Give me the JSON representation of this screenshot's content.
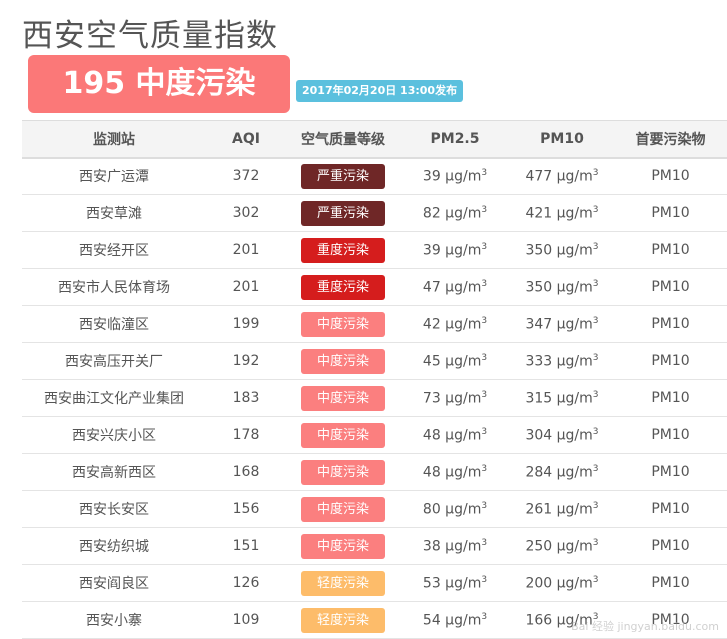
{
  "title": "西安空气质量指数",
  "summary": {
    "aqi_text": "195 中度污染",
    "published": "2017年02月20日 13:00发布"
  },
  "table": {
    "headers": [
      "监测站",
      "AQI",
      "空气质量等级",
      "PM2.5",
      "PM10",
      "首要污染物"
    ],
    "rows": [
      {
        "station": "西安广运潭",
        "aqi": "372",
        "level": "严重污染",
        "color": "#6f2727",
        "pm25": "39 μg/m",
        "pm10": "477 μg/m",
        "primary": "PM10"
      },
      {
        "station": "西安草滩",
        "aqi": "302",
        "level": "严重污染",
        "color": "#6f2727",
        "pm25": "82 μg/m",
        "pm10": "421 μg/m",
        "primary": "PM10"
      },
      {
        "station": "西安经开区",
        "aqi": "201",
        "level": "重度污染",
        "color": "#d51d1d",
        "pm25": "39 μg/m",
        "pm10": "350 μg/m",
        "primary": "PM10"
      },
      {
        "station": "西安市人民体育场",
        "aqi": "201",
        "level": "重度污染",
        "color": "#d51d1d",
        "pm25": "47 μg/m",
        "pm10": "350 μg/m",
        "primary": "PM10"
      },
      {
        "station": "西安临潼区",
        "aqi": "199",
        "level": "中度污染",
        "color": "#fb7f7f",
        "pm25": "42 μg/m",
        "pm10": "347 μg/m",
        "primary": "PM10"
      },
      {
        "station": "西安高压开关厂",
        "aqi": "192",
        "level": "中度污染",
        "color": "#fb7f7f",
        "pm25": "45 μg/m",
        "pm10": "333 μg/m",
        "primary": "PM10"
      },
      {
        "station": "西安曲江文化产业集团",
        "aqi": "183",
        "level": "中度污染",
        "color": "#fb7f7f",
        "pm25": "73 μg/m",
        "pm10": "315 μg/m",
        "primary": "PM10"
      },
      {
        "station": "西安兴庆小区",
        "aqi": "178",
        "level": "中度污染",
        "color": "#fb7f7f",
        "pm25": "48 μg/m",
        "pm10": "304 μg/m",
        "primary": "PM10"
      },
      {
        "station": "西安高新西区",
        "aqi": "168",
        "level": "中度污染",
        "color": "#fb7f7f",
        "pm25": "48 μg/m",
        "pm10": "284 μg/m",
        "primary": "PM10"
      },
      {
        "station": "西安长安区",
        "aqi": "156",
        "level": "中度污染",
        "color": "#fb7f7f",
        "pm25": "80 μg/m",
        "pm10": "261 μg/m",
        "primary": "PM10"
      },
      {
        "station": "西安纺织城",
        "aqi": "151",
        "level": "中度污染",
        "color": "#fb7f7f",
        "pm25": "38 μg/m",
        "pm10": "250 μg/m",
        "primary": "PM10"
      },
      {
        "station": "西安阎良区",
        "aqi": "126",
        "level": "轻度污染",
        "color": "#fdbc6a",
        "pm25": "53 μg/m",
        "pm10": "200 μg/m",
        "primary": "PM10"
      },
      {
        "station": "西安小寨",
        "aqi": "109",
        "level": "轻度污染",
        "color": "#fdbc6a",
        "pm25": "54 μg/m",
        "pm10": "166 μg/m",
        "primary": "PM10"
      }
    ]
  },
  "unit_superscript": "3",
  "watermark": "Bai 经验 jingyan.baidu.com"
}
